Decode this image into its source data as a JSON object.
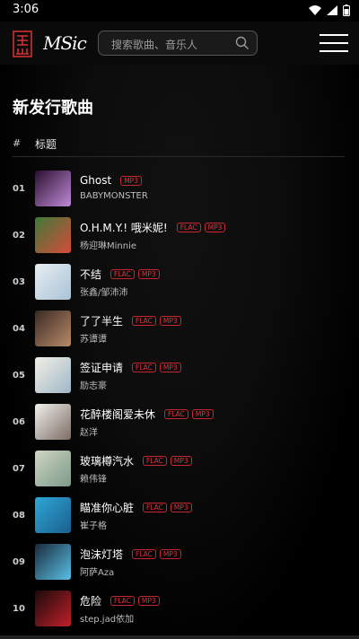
{
  "status": {
    "time": "3:06"
  },
  "header": {
    "logo_text": "MSic",
    "search_placeholder": "搜索歌曲、音乐人"
  },
  "page": {
    "title": "新发行歌曲",
    "col_hash": "#",
    "col_title": "标题"
  },
  "songs": [
    {
      "rank": "01",
      "title": "Ghost",
      "artist": "BABYMONSTER",
      "badges": [
        "MP3"
      ],
      "cover": [
        "#2a0f2e",
        "#c08ad8"
      ]
    },
    {
      "rank": "02",
      "title": "O.H.M.Y.! 哦米妮!",
      "artist": "杨迎琳Minnie",
      "badges": [
        "FLAC",
        "MP3"
      ],
      "cover": [
        "#3f7a39",
        "#d64b3a"
      ]
    },
    {
      "rank": "03",
      "title": "不结",
      "artist": "张鑫/邹沛沛",
      "badges": [
        "FLAC",
        "MP3"
      ],
      "cover": [
        "#e8eef2",
        "#a9c3d6"
      ]
    },
    {
      "rank": "04",
      "title": "了了半生",
      "artist": "苏谭谭",
      "badges": [
        "FLAC",
        "MP3"
      ],
      "cover": [
        "#3a2a22",
        "#b98a6a"
      ]
    },
    {
      "rank": "05",
      "title": "签证申请",
      "artist": "励志豪",
      "badges": [
        "FLAC",
        "MP3"
      ],
      "cover": [
        "#f2efe6",
        "#9fb7c8"
      ]
    },
    {
      "rank": "06",
      "title": "花醉楼阁爱未休",
      "artist": "赵洋",
      "badges": [
        "FLAC",
        "MP3"
      ],
      "cover": [
        "#f1efec",
        "#7b6d64"
      ]
    },
    {
      "rank": "07",
      "title": "玻璃樽汽水",
      "artist": "赖伟锋",
      "badges": [
        "FLAC",
        "MP3"
      ],
      "cover": [
        "#cfd6c2",
        "#7c9a8a"
      ]
    },
    {
      "rank": "08",
      "title": "瞄准你心脏",
      "artist": "崔子格",
      "badges": [
        "FLAC",
        "MP3"
      ],
      "cover": [
        "#2fa6d6",
        "#1a5f8c"
      ]
    },
    {
      "rank": "09",
      "title": "泡沫灯塔",
      "artist": "阿萨Aza",
      "badges": [
        "FLAC",
        "MP3"
      ],
      "cover": [
        "#1a2a3a",
        "#5ac0e8"
      ]
    },
    {
      "rank": "10",
      "title": "危险",
      "artist": "step.jad依加",
      "badges": [
        "FLAC",
        "MP3"
      ],
      "cover": [
        "#1a0a0a",
        "#c0202a"
      ]
    }
  ],
  "colors": {
    "accent": "#e0313a",
    "badge_border": "#c4282f"
  }
}
